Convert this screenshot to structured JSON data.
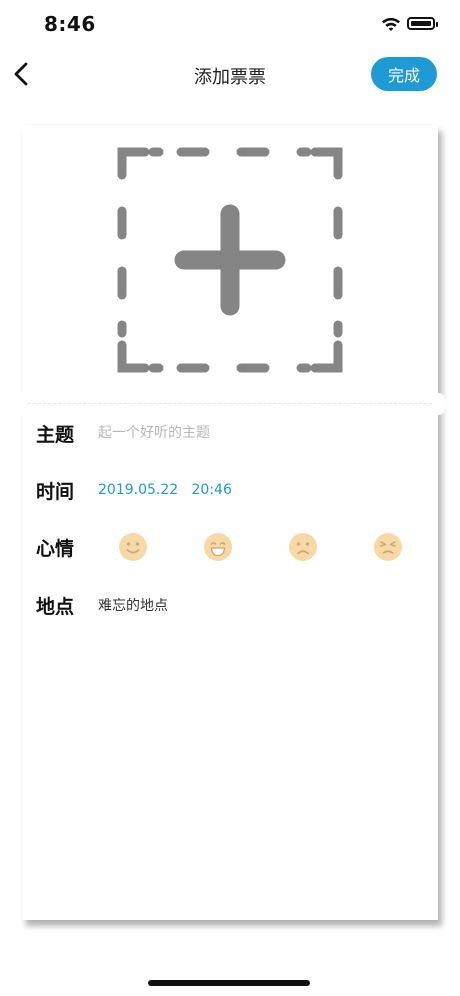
{
  "status_bar": {
    "time": "8:46",
    "icons": [
      "wifi-icon",
      "battery-icon"
    ]
  },
  "nav": {
    "back_icon": "chevron-left-icon",
    "title": "添加票票",
    "done_label": "完成"
  },
  "colors": {
    "accent": "#1e9ad6",
    "mood_face": "#f8d9a6",
    "placeholder": "#b8b8b8"
  },
  "ticket": {
    "image_picker_icon": "add-image-icon",
    "fields": {
      "subject": {
        "label": "主题",
        "placeholder": "起一个好听的主题",
        "value": ""
      },
      "time": {
        "label": "时间",
        "value": "2019.05.22   20:46"
      },
      "mood": {
        "label": "心情",
        "options": [
          "smile-face-icon",
          "grin-face-icon",
          "frown-face-icon",
          "annoyed-face-icon"
        ]
      },
      "place": {
        "label": "地点",
        "value": "难忘的地点"
      }
    }
  }
}
